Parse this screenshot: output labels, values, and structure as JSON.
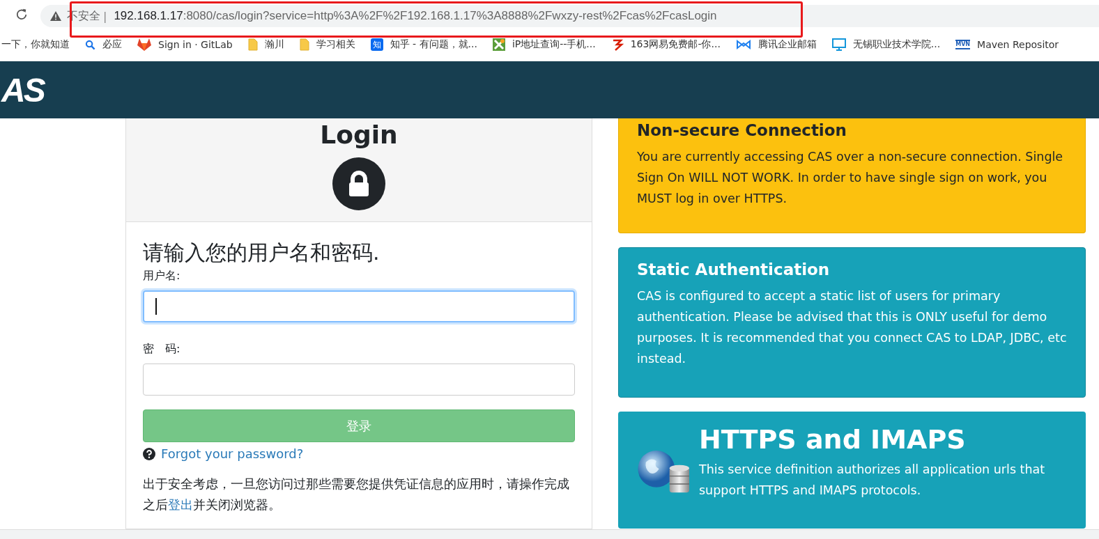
{
  "browser": {
    "security_label": "不安全",
    "separator": "|",
    "url_host": "192.168.1.17",
    "url_rest": ":8080/cas/login?service=http%3A%2F%2F192.168.1.17%3A8888%2Fwxzy-rest%2Fcas%2FcasLogin",
    "highlighted": true
  },
  "bookmarks": [
    {
      "kind": "none",
      "label": "一下，你就知道"
    },
    {
      "kind": "search",
      "label": "必应"
    },
    {
      "kind": "gitlab",
      "label": "Sign in · GitLab"
    },
    {
      "kind": "folder",
      "label": "瀚川"
    },
    {
      "kind": "folder",
      "label": "学习相关"
    },
    {
      "kind": "zhihu",
      "icon_text": "知",
      "label": "知乎 - 有问题，就..."
    },
    {
      "kind": "tools",
      "label": "iP地址查询--手机..."
    },
    {
      "kind": "mail163",
      "label": "163网易免费邮-你..."
    },
    {
      "kind": "tencent",
      "label": "腾讯企业邮箱"
    },
    {
      "kind": "monitor",
      "label": "无锡职业技术学院..."
    },
    {
      "kind": "maven",
      "icon_text": "MVN",
      "label": "Maven Repositor"
    }
  ],
  "header": {
    "logo_text": "AS"
  },
  "login": {
    "title": "Login",
    "heading": "请输入您的用户名和密码.",
    "fields": [
      {
        "label": "用户名:",
        "focused": true
      },
      {
        "label": "密　码:",
        "focused": false
      }
    ],
    "submit": "登录",
    "forgot": "Forgot your password?",
    "notice_before": "出于安全考虑，一旦您访问过那些需要您提供凭证信息的应用时，请操作完成之后",
    "notice_link": "登出",
    "notice_after": "并关闭浏览器。"
  },
  "cards": [
    {
      "kind": "warning",
      "title": "Non-secure Connection",
      "body": "You are currently accessing CAS over a non-secure connection. Single Sign On WILL NOT WORK. In order to have single sign on work, you MUST log in over HTTPS."
    },
    {
      "kind": "info",
      "title": "Static Authentication",
      "body": "CAS is configured to accept a static list of users for primary authentication. Please be advised that this is ONLY useful for demo purposes. It is recommended that you connect CAS to LDAP, JDBC, etc instead."
    },
    {
      "kind": "service",
      "title": "HTTPS and IMAPS",
      "body": "This service definition authorizes all application urls that support HTTPS and IMAPS protocols."
    }
  ]
}
